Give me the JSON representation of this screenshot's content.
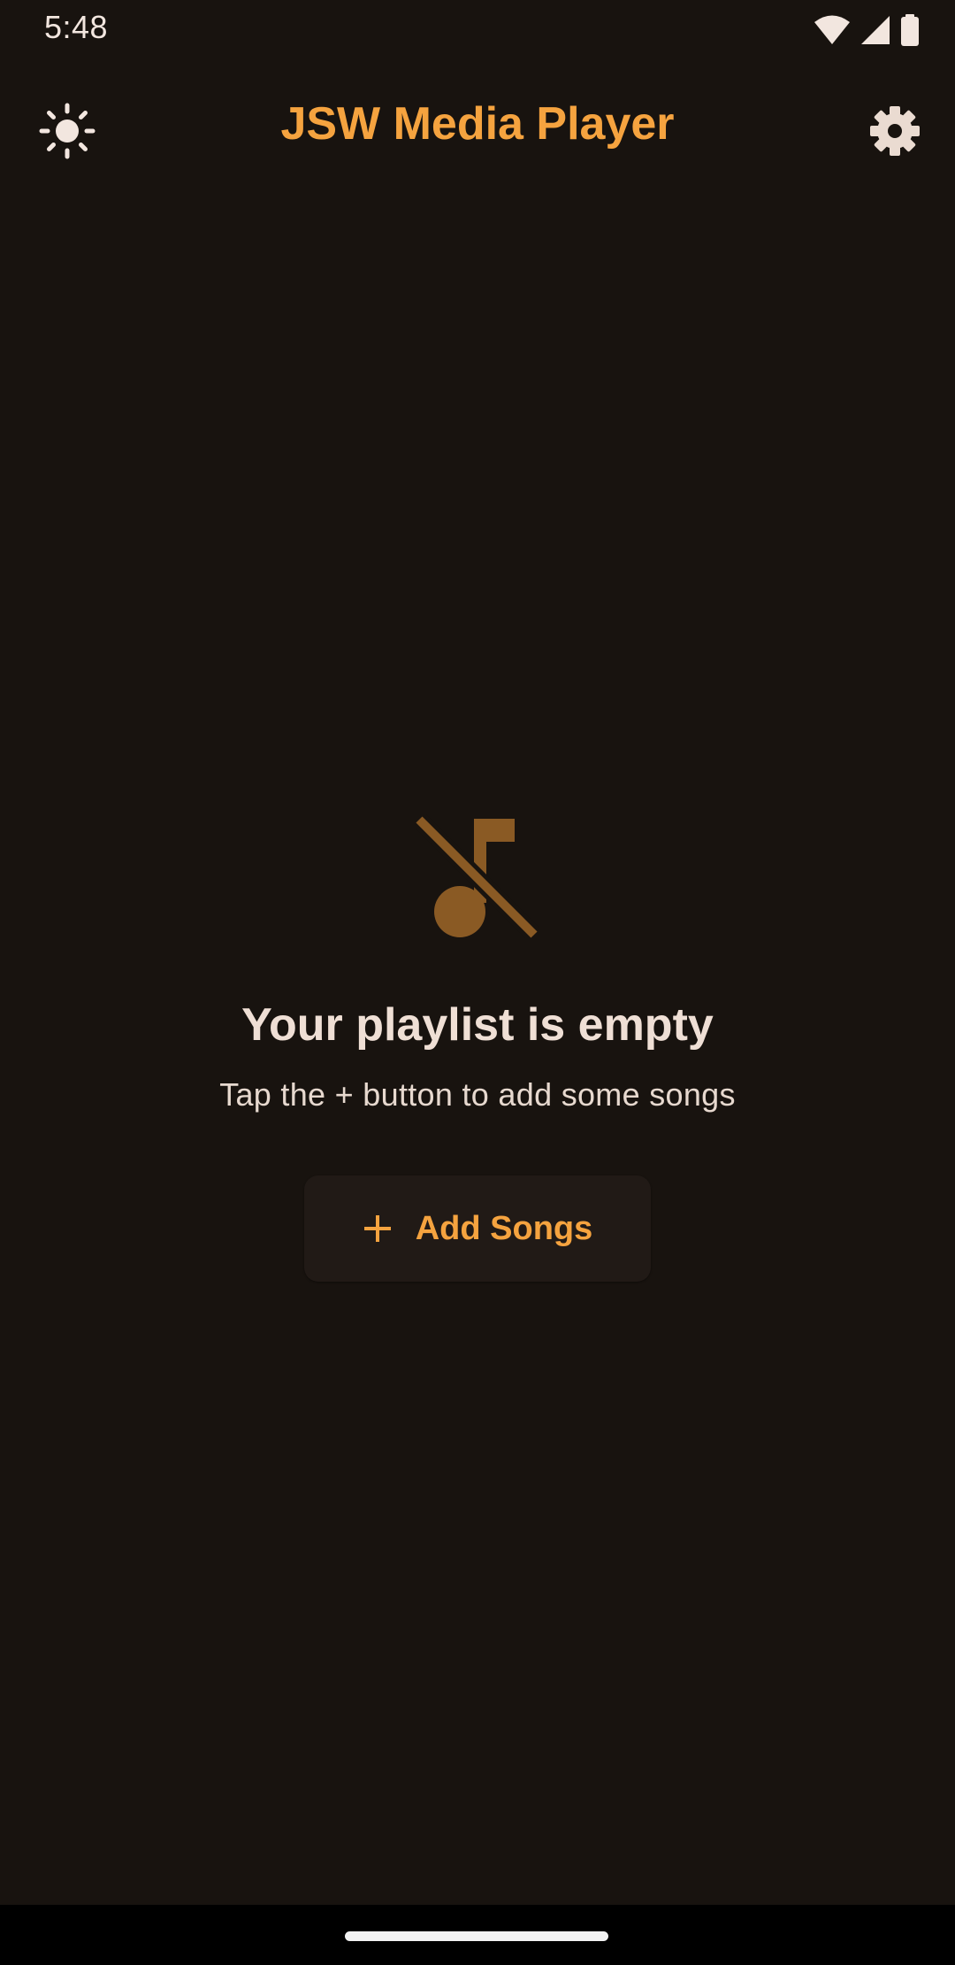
{
  "status_bar": {
    "time": "5:48",
    "icons": [
      "wifi-icon",
      "cellular-signal-icon",
      "battery-icon"
    ]
  },
  "app_bar": {
    "title": "JSW Media Player",
    "left_icon": "brightness-icon",
    "right_icon": "gear-icon"
  },
  "empty_state": {
    "icon": "music-off-icon",
    "title": "Your playlist is empty",
    "subtitle": "Tap the + button to add some songs",
    "button_icon": "plus-icon",
    "button_label": "Add Songs"
  },
  "colors": {
    "background": "#18130f",
    "accent": "#f5a33f",
    "icon_muted": "#8a5a24",
    "text_primary": "#efdfd5",
    "button_surface": "#211a16"
  }
}
